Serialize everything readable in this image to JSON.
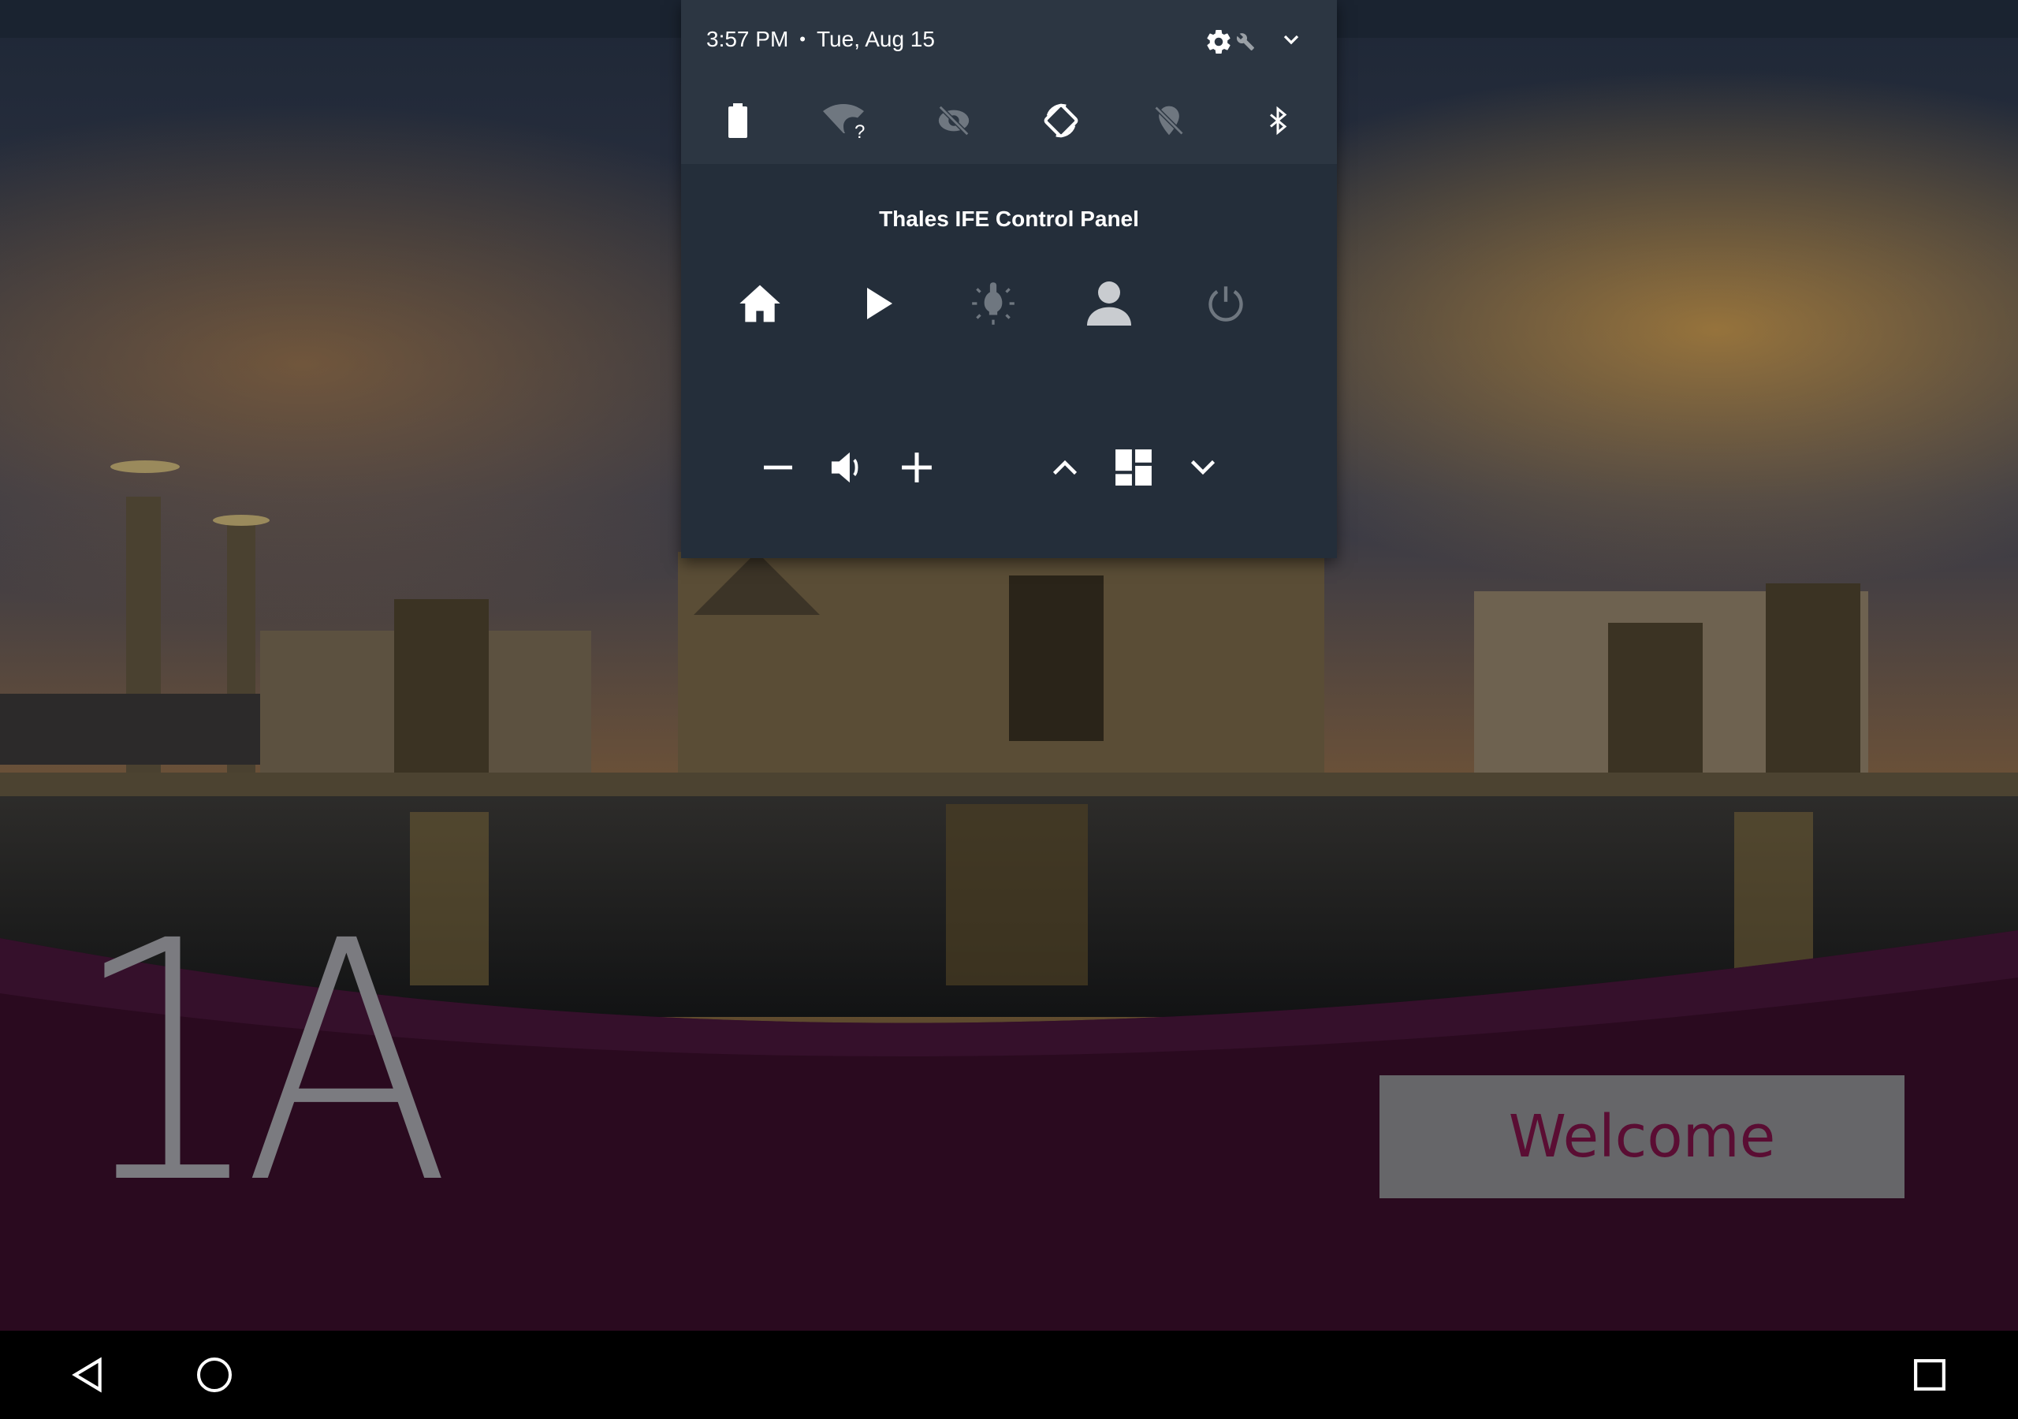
{
  "status": {
    "time": "3:57 PM",
    "separator": "•",
    "date": "Tue, Aug 15"
  },
  "quick_settings": {
    "settings_icon": "gear-icon",
    "tuner_icon": "wrench-icon",
    "expand_icon": "chevron-down-icon",
    "tiles": [
      {
        "name": "battery",
        "icon": "battery-icon"
      },
      {
        "name": "wifi",
        "icon": "wifi-unknown-icon",
        "badge": "?"
      },
      {
        "name": "do-not-disturb",
        "icon": "dnd-off-icon"
      },
      {
        "name": "auto-rotate",
        "icon": "rotate-icon"
      },
      {
        "name": "location",
        "icon": "location-off-icon"
      },
      {
        "name": "bluetooth",
        "icon": "bluetooth-icon"
      }
    ]
  },
  "ife_panel": {
    "title": "Thales IFE Control Panel",
    "top_buttons": [
      "home-icon",
      "play-icon",
      "reading-light-icon",
      "attendant-call-icon",
      "power-icon"
    ],
    "bottom_buttons": [
      "volume-down-icon",
      "volume-icon",
      "volume-up-icon",
      "brightness-up-icon",
      "layout-icon",
      "brightness-down-icon"
    ]
  },
  "seat": {
    "label": "1A"
  },
  "welcome": {
    "label": "Welcome"
  },
  "nav": {
    "back": "back-icon",
    "home": "home-circle-icon",
    "recents": "recents-icon"
  },
  "colors": {
    "accent": "#5a0d33",
    "panel_bg": "#242e3a",
    "qs_bg": "#2c3642",
    "band": "#2a0a1f"
  }
}
